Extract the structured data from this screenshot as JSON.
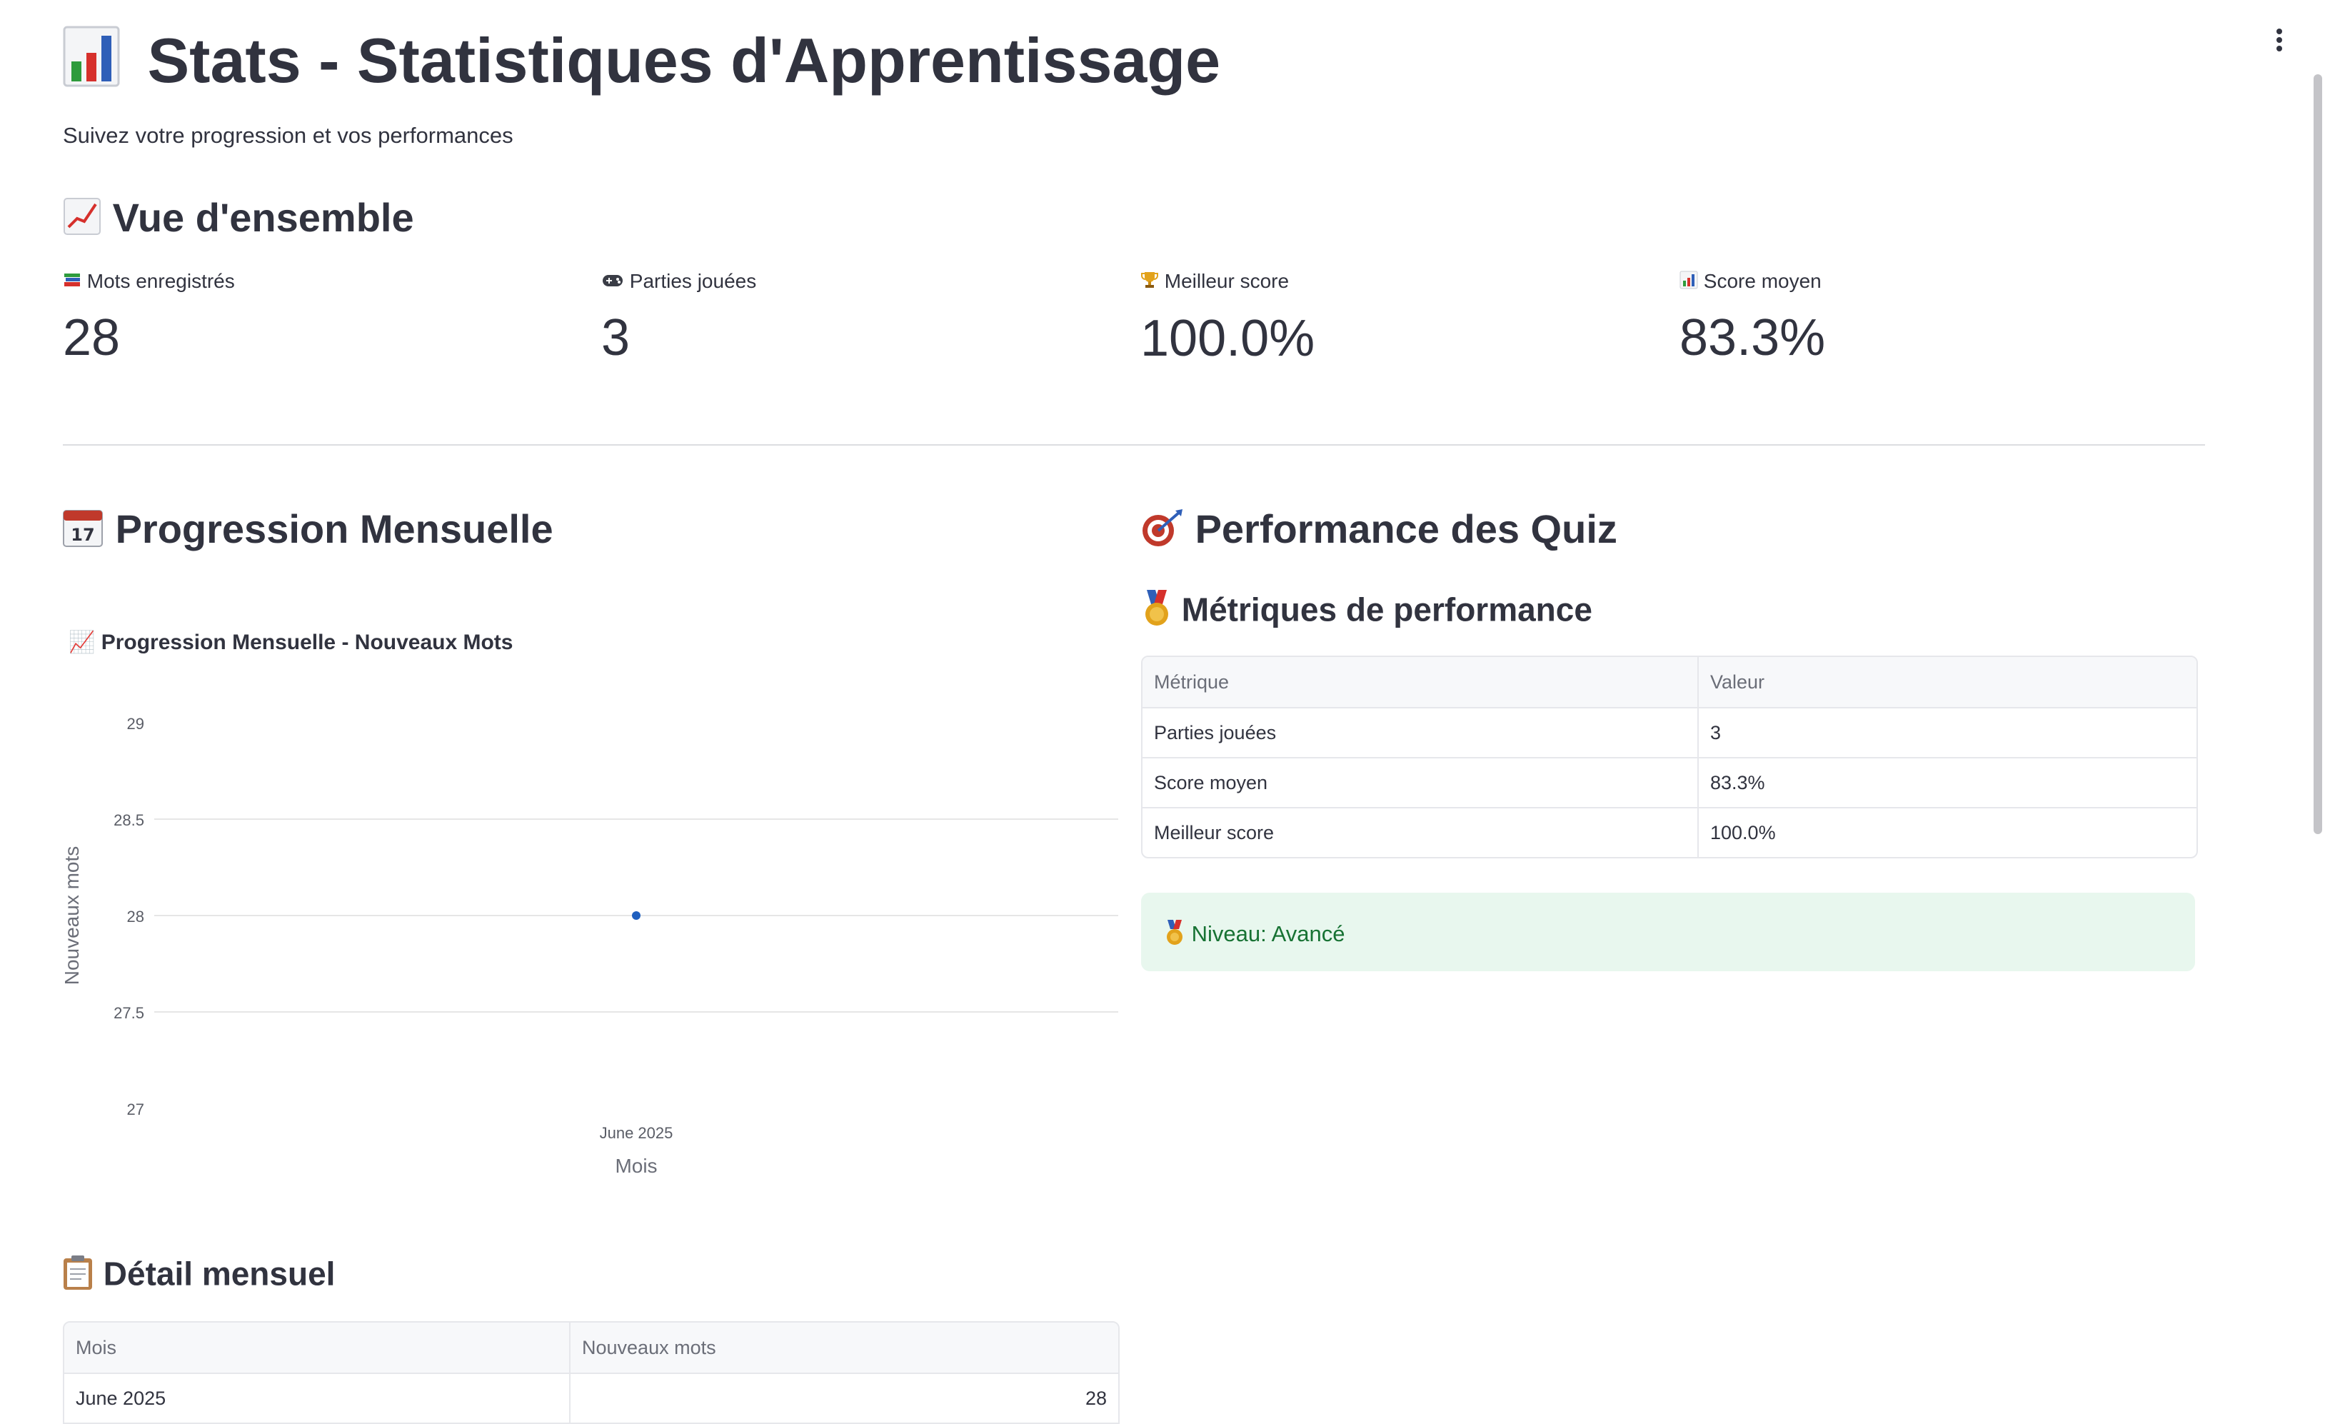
{
  "header": {
    "title_icon": "bar-chart-icon",
    "title": "Stats - Statistiques d'Apprentissage",
    "subtitle": "Suivez votre progression et vos performances"
  },
  "overview": {
    "heading_icon": "chart-increasing-icon",
    "heading": "Vue d'ensemble",
    "metrics": [
      {
        "icon": "books-icon",
        "label": "Mots enregistrés",
        "value": "28"
      },
      {
        "icon": "game-controller-icon",
        "label": "Parties jouées",
        "value": "3"
      },
      {
        "icon": "trophy-icon",
        "label": "Meilleur score",
        "value": "100.0%"
      },
      {
        "icon": "bar-chart-icon",
        "label": "Score moyen",
        "value": "83.3%"
      }
    ]
  },
  "monthly": {
    "heading_icon": "calendar-icon",
    "heading": "Progression Mensuelle",
    "chart_title": "Progression Mensuelle - Nouveaux Mots",
    "detail_heading": "Détail mensuel",
    "table": {
      "headers": [
        "Mois",
        "Nouveaux mots"
      ],
      "rows": [
        [
          "June 2025",
          "28"
        ]
      ]
    }
  },
  "quiz": {
    "heading_icon": "target-icon",
    "heading": "Performance des Quiz",
    "metrics_heading": "Métriques de performance",
    "table": {
      "headers": [
        "Métrique",
        "Valeur"
      ],
      "rows": [
        [
          "Parties jouées",
          "3"
        ],
        [
          "Score moyen",
          "83.3%"
        ],
        [
          "Meilleur score",
          "100.0%"
        ]
      ]
    },
    "level_text": "Niveau: Avancé"
  },
  "colors": {
    "point": "#1f5fbf",
    "grid": "#e6e6e6",
    "level_bg": "#e8f7ee",
    "level_text": "#177233"
  },
  "chart_data": {
    "type": "scatter",
    "title": "📈 Progression Mensuelle - Nouveaux Mots",
    "x": [
      "June 2025"
    ],
    "y": [
      28
    ],
    "xlabel": "Mois",
    "ylabel": "Nouveaux mots",
    "ylim": [
      27,
      29
    ],
    "yticks": [
      27,
      27.5,
      28,
      28.5,
      29
    ],
    "grid": true
  }
}
